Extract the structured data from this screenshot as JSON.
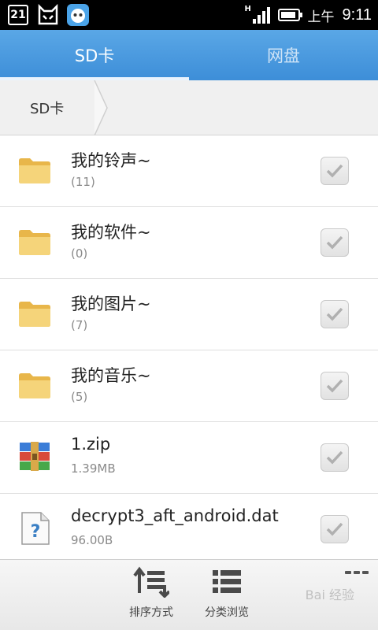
{
  "status_bar": {
    "calendar_day": "21",
    "network": "H",
    "ampm": "上午",
    "time": "9:11"
  },
  "tabs": [
    {
      "label": "SD卡",
      "active": true
    },
    {
      "label": "网盘",
      "active": false
    }
  ],
  "breadcrumb": {
    "label": "SD卡"
  },
  "files": [
    {
      "name": "我的铃声~",
      "detail": "(11)",
      "icon": "folder-icon"
    },
    {
      "name": "我的软件~",
      "detail": "(0)",
      "icon": "folder-icon"
    },
    {
      "name": "我的图片~",
      "detail": "(7)",
      "icon": "folder-icon"
    },
    {
      "name": "我的音乐~",
      "detail": "(5)",
      "icon": "folder-icon"
    },
    {
      "name": "1.zip",
      "detail": "1.39MB",
      "icon": "archive-icon"
    },
    {
      "name": "decrypt3_aft_android.dat",
      "detail": "96.00B",
      "icon": "unknown-file-icon"
    }
  ],
  "toolbar": {
    "sort_label": "排序方式",
    "category_label": "分类浏览"
  },
  "watermark": "Bai 经验",
  "colors": {
    "accent": "#3d8ed8",
    "folder": "#f0c65a"
  }
}
